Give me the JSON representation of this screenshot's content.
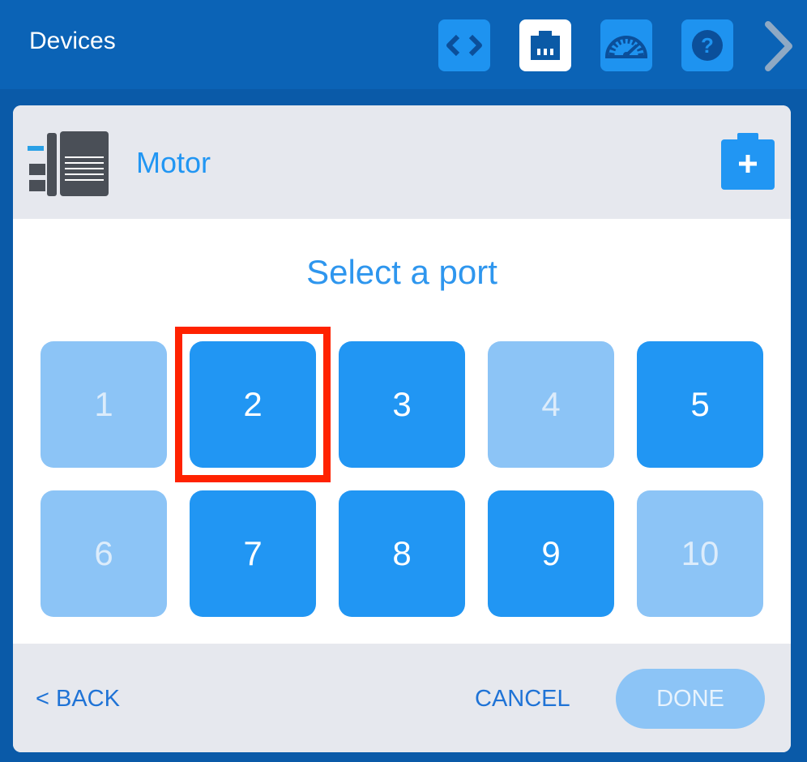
{
  "topbar": {
    "title": "Devices",
    "buttons": [
      {
        "icon": "code-icon"
      },
      {
        "icon": "port-icon",
        "active": true
      },
      {
        "icon": "dashboard-gauge-icon"
      },
      {
        "icon": "help-icon"
      }
    ],
    "next_icon": "chevron-right-icon"
  },
  "device": {
    "name": "Motor",
    "icon": "motor-icon",
    "add_icon": "add-device-icon"
  },
  "port_select": {
    "heading": "Select a port",
    "ports": [
      {
        "label": "1",
        "enabled": false
      },
      {
        "label": "2",
        "enabled": true,
        "highlighted": true
      },
      {
        "label": "3",
        "enabled": true
      },
      {
        "label": "4",
        "enabled": false
      },
      {
        "label": "5",
        "enabled": true
      },
      {
        "label": "6",
        "enabled": false
      },
      {
        "label": "7",
        "enabled": true
      },
      {
        "label": "8",
        "enabled": true
      },
      {
        "label": "9",
        "enabled": true
      },
      {
        "label": "10",
        "enabled": false
      }
    ]
  },
  "footer": {
    "back_label": "< BACK",
    "cancel_label": "CANCEL",
    "done_label": "DONE"
  },
  "colors": {
    "topbar": "#0b63b6",
    "accent": "#2196f3",
    "disabled": "#8cc4f6",
    "highlight": "#ff2200"
  }
}
